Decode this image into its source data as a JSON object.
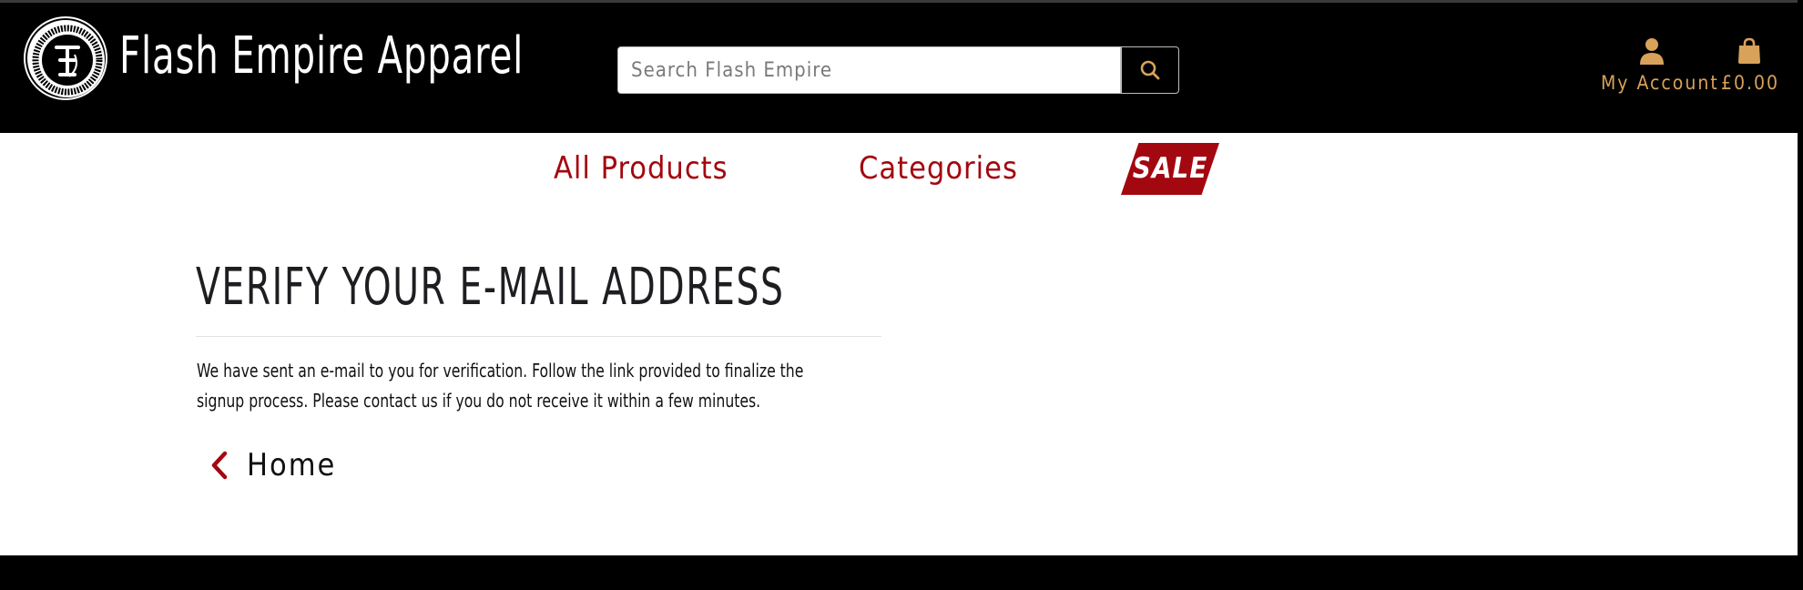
{
  "header": {
    "brand_name": "Flash Empire Apparel",
    "search": {
      "placeholder": "Search Flash Empire",
      "value": ""
    },
    "account_label": "My Account",
    "cart_total": "£0.00"
  },
  "nav": {
    "items": [
      {
        "label": "All Products"
      },
      {
        "label": "Categories"
      },
      {
        "label": "SALE"
      }
    ]
  },
  "main": {
    "title": "VERIFY YOUR E-MAIL ADDRESS",
    "message": "We have sent an e-mail to you for verification. Follow the link provided to finalize the signup process. Please contact us if you do not receive it within a few minutes.",
    "home_link_label": "Home"
  },
  "icons": {
    "logo": "flash-empire-logo",
    "search": "search-icon",
    "account": "user-icon",
    "cart": "shopping-bag-icon",
    "home": "chevron-left-icon"
  },
  "colors": {
    "header_bg": "#000000",
    "accent_gold": "#d8a25a",
    "accent_red": "#a3070f",
    "text_dark": "#1e1e22"
  }
}
